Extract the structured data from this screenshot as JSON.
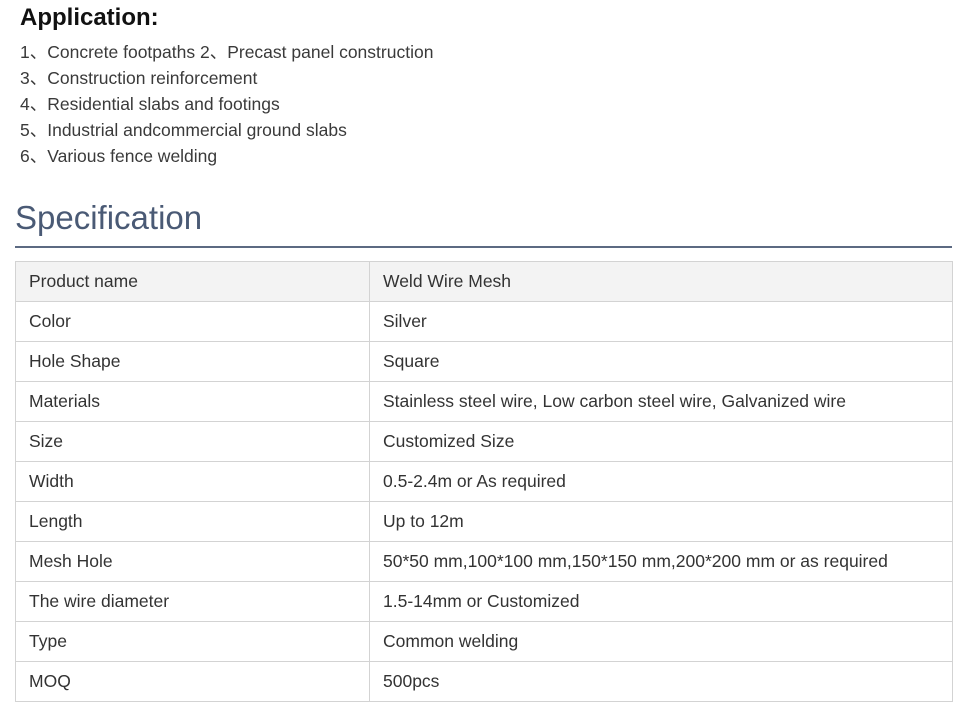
{
  "application": {
    "title": "Application:",
    "items": [
      "1、Concrete footpaths 2、Precast panel construction",
      "3、Construction reinforcement",
      "4、Residential slabs and footings",
      "5、Industrial andcommercial ground slabs",
      "6、Various fence welding"
    ]
  },
  "specification": {
    "title": "Specification",
    "rows": [
      {
        "label": "Product name",
        "value": "Weld Wire Mesh"
      },
      {
        "label": "Color",
        "value": "Silver"
      },
      {
        "label": "Hole Shape",
        "value": "Square"
      },
      {
        "label": "Materials",
        "value": "Stainless steel wire, Low carbon steel wire, Galvanized wire"
      },
      {
        "label": "Size",
        "value": "Customized Size"
      },
      {
        "label": "Width",
        "value": "0.5-2.4m or As required"
      },
      {
        "label": "Length",
        "value": "Up to 12m"
      },
      {
        "label": "Mesh Hole",
        "value": "50*50 mm,100*100 mm,150*150 mm,200*200 mm or as required"
      },
      {
        "label": "The wire diameter",
        "value": "1.5-14mm or Customized"
      },
      {
        "label": "Type",
        "value": "Common welding"
      },
      {
        "label": "MOQ",
        "value": "500pcs"
      }
    ]
  }
}
